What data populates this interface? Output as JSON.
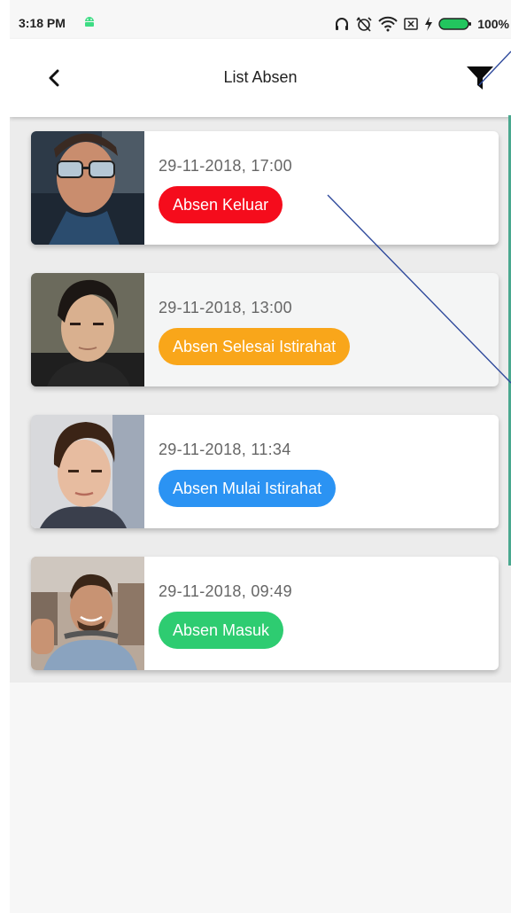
{
  "status_bar": {
    "time": "3:18 PM",
    "battery": "100%"
  },
  "app_bar": {
    "title": "List Absen"
  },
  "items": [
    {
      "date": "29-11-2018, 17:00",
      "status": "Absen Keluar",
      "color": "#f50c1c"
    },
    {
      "date": "29-11-2018, 13:00",
      "status": "Absen Selesai Istirahat",
      "color": "#f9a61a"
    },
    {
      "date": "29-11-2018, 11:34",
      "status": "Absen Mulai Istirahat",
      "color": "#2b93f3"
    },
    {
      "date": "29-11-2018, 09:49",
      "status": "Absen Masuk",
      "color": "#2ecc71"
    }
  ]
}
